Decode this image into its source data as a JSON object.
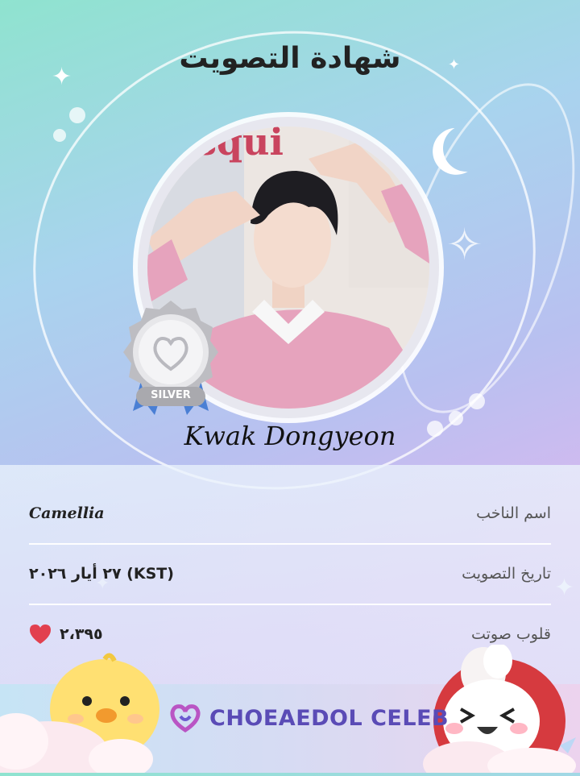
{
  "certificate": {
    "title": "شهادة التصويت",
    "celebrity_name": "Kwak Dongyeon",
    "badge_label": "SILVER"
  },
  "info": {
    "voter_label": "اسم الناخب",
    "voter_value": "Camellia",
    "date_label": "تاريخ التصويت",
    "date_value": "٢٧ أيار ٢٠٢٦ (KST)",
    "hearts_label": "قلوب صوتت",
    "hearts_value": "٢،٣٩٥"
  },
  "footer": {
    "brand": "CHOEAEDOL CELEB"
  },
  "colors": {
    "heart": "#e2404f",
    "brand": "#5a4bb6",
    "badge_silver": "#c9c9cc",
    "ribbon": "#4a7fd4"
  },
  "icons": [
    "sparkle-icon",
    "moon-icon",
    "silver-badge-icon",
    "heart-icon",
    "brand-logo-icon",
    "chick-character",
    "bunny-character"
  ]
}
